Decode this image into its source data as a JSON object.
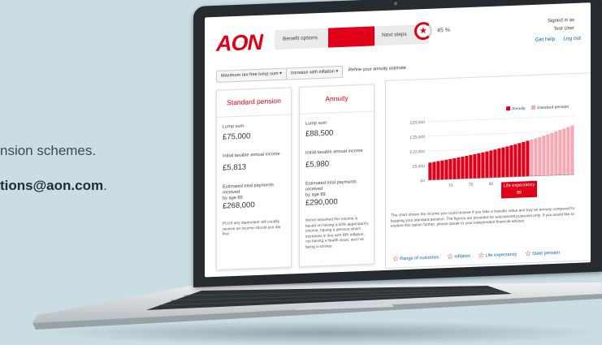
{
  "background": {
    "line1": "nsion schemes.",
    "line2_bold": "tions@aon.com",
    "line2_tail": "."
  },
  "header": {
    "logo": "AON",
    "nav_benefit": "Benefit options",
    "nav_next": "Next steps",
    "progress_percent": 45,
    "progress_label": "45 %",
    "signed_in_line": "Signed in as",
    "user_name": "Test User",
    "get_help": "Get help",
    "log_out": "Log out"
  },
  "toolbar": {
    "lump_sum": "Maximum tax-free lump sum",
    "inflation": "Increase with inflation",
    "refine": "Refine your annuity estimate"
  },
  "standard": {
    "title": "Standard pension",
    "lump_label": "Lump sum",
    "lump_value": "£75,000",
    "income_label": "Initial taxable annual income",
    "income_value": "£5,813",
    "total_label_1": "Estimated total payments received",
    "total_label_2": "by age 89",
    "total_value": "£268,000",
    "note": "PLUS any dependant will usually receive an income should you die first."
  },
  "annuity": {
    "title": "Annuity",
    "lump_label": "Lump sum",
    "lump_value": "£88,500",
    "income_label": "Initial taxable annual income",
    "income_value": "£5,980",
    "total_label_1": "Estimated total payments received",
    "total_label_2": "by age 89",
    "total_value": "£290,000",
    "note": "We've assumed this income is based on having a 50% dependant's income, having a pension which increases in line with RPI inflation, not having a health issue, and not being a smoker."
  },
  "chart_data": {
    "type": "bar",
    "legend": [
      "Annuity",
      "Standard pension"
    ],
    "legend_position": "top-right",
    "y_ticks": [
      "£20,000",
      "£15,000",
      "£10,000",
      "£5,000",
      "£0"
    ],
    "x_ticks": [
      "70",
      "75",
      "80",
      "85",
      "90"
    ],
    "ylim": [
      0,
      20000
    ],
    "start_age": 65,
    "end_age": 100,
    "start_value": 5980,
    "growth": 1.03,
    "life_expectancy_age": 89,
    "tooltip_title": "Life expectancy",
    "tooltip_value": "89",
    "colors": {
      "annuity": "#e1001a",
      "standard": "#f4a9b4",
      "axis": "#888888"
    }
  },
  "chart_note": "The chart shows the income you could receive if you take a transfer value and buy an annuity compared to keeping your standard pension. The figures are provided for educational purposes only. If you would like to explore this option further, please speak to your independent financial advisor.",
  "chart_links": [
    "Range of outcomes",
    "Inflation",
    "Life expectancy",
    "State pension"
  ]
}
